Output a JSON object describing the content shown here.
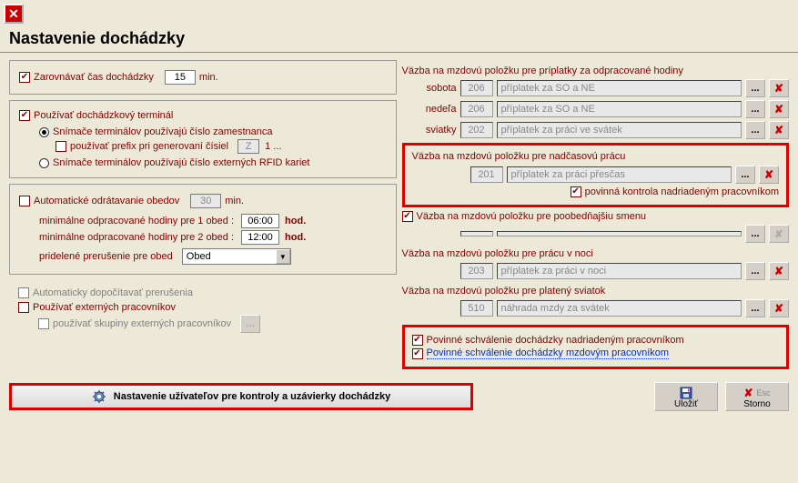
{
  "title": "Nastavenie dochádzky",
  "left": {
    "alignTime": "Zarovnávať čas  dochádzky",
    "alignVal": "15",
    "min": "min.",
    "useTerminal": "Používať dochádzkový terminál",
    "radioEmp": "Snímače terminálov používajú číslo zamestnanca",
    "usePrefix": "používať prefix pri generovaní čísiel",
    "prefixVal": "Z",
    "prefixSep": "1 ...",
    "radioRfid": "Snímače terminálov používajú číslo externých RFID kariet",
    "autoLunch": "Automatické odrátavanie obedov",
    "autoLunchVal": "30",
    "min2": "min.",
    "minH1": "minimálne odpracované hodiny pre 1 obed :",
    "minH1Val": "06:00",
    "minH2": "minimálne odpracované hodiny pre 2 obed :",
    "minH2Val": "12:00",
    "breakLabel": "pridelené prerušenie pre obed",
    "breakVal": "Obed",
    "hod": "hod.",
    "autoBreaks": "Automaticky dopočítavať prerušenia",
    "useExt": "Používať externých pracovníkov",
    "useExtGroups": "používať skupiny externých pracovníkov"
  },
  "right": {
    "head1": "Väzba na mzdovú položku  pre príplatky za odpracované hodiny",
    "sobota": "sobota",
    "sobotaCode": "206",
    "sobotaDesc": "příplatek za SO a NE",
    "nedela": "nedeľa",
    "nedelaCode": "206",
    "nedelaDesc": "příplatek za SO a NE",
    "sviatky": "sviatky",
    "sviatkyCode": "202",
    "sviatkyDesc": "příplatek za práci ve svátek",
    "head2": "Väzba na mzdovú položku pre nadčasovú prácu",
    "overCode": "201",
    "overDesc": "příplatek za práci přesčas",
    "overCheck": "povinná kontrola nadriadeným pracovníkom",
    "head3": "Väzba na mzdovú položku pre poobedňajšiu smenu",
    "head4": "Väzba na mzdovú položku  pre prácu v noci",
    "nightCode": "203",
    "nightDesc": "příplatek za práci v noci",
    "head5": "Väzba na mzdovú položku  pre platený sviatok",
    "holCode": "510",
    "holDesc": "náhrada mzdy za svátek",
    "approve1": "Povinné schválenie dochádzky nadriadeným pracovníkom",
    "approve2": "Povinné schválenie dochádzky mzdovým pracovníkom"
  },
  "footer": {
    "longBtn": "Nastavenie užívateľov pre kontroly a uzávierky dochádzky",
    "save": "Uložiť",
    "cancel": "Storno",
    "esc": "Esc"
  }
}
